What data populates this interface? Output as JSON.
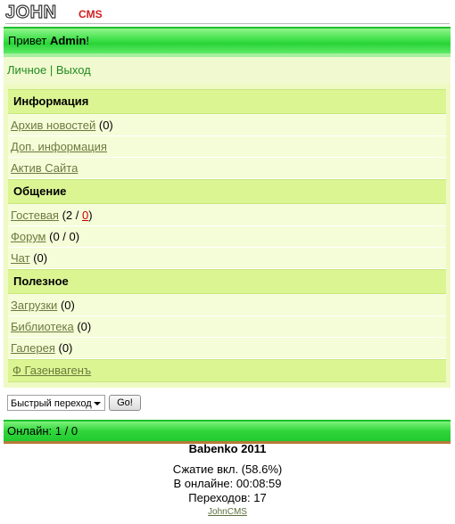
{
  "logo": {
    "main": "JOHN",
    "sub": "CMS"
  },
  "header": {
    "greeting": "Привет ",
    "user": "Admin",
    "excl": "!"
  },
  "topmenu": {
    "personal": "Личное",
    "separator": "|",
    "logout": "Выход"
  },
  "sections": [
    {
      "title": "Информация",
      "items": [
        {
          "label": "Архив новостей",
          "count": "(0)"
        },
        {
          "label": "Доп. информация",
          "count": ""
        },
        {
          "label": "Актив Сайта",
          "count": ""
        }
      ]
    },
    {
      "title": "Общение",
      "items": [
        {
          "label": "Гостевая",
          "count": "(2 / ",
          "red": "0",
          "tail": ")"
        },
        {
          "label": "Форум",
          "count": "(0 / 0)"
        },
        {
          "label": "Чат",
          "count": "(0)"
        }
      ]
    },
    {
      "title": "Полезное",
      "items": [
        {
          "label": "Загрузки",
          "count": "(0)"
        },
        {
          "label": "Библиотека",
          "count": "(0)"
        },
        {
          "label": "Галерея",
          "count": "(0)"
        }
      ]
    }
  ],
  "extra_link": "Ф Газенвагенъ",
  "quick": {
    "select_value": "Быстрый переход",
    "go": "Go!"
  },
  "online": "Онлайн: 1 / 0",
  "footer": {
    "copyright": "Babenko 2011",
    "compression": "Сжатие вкл. (58.6%)",
    "online_time": "В онлайне: 00:08:59",
    "transitions": "Переходов: 17",
    "link": "JohnCMS"
  }
}
